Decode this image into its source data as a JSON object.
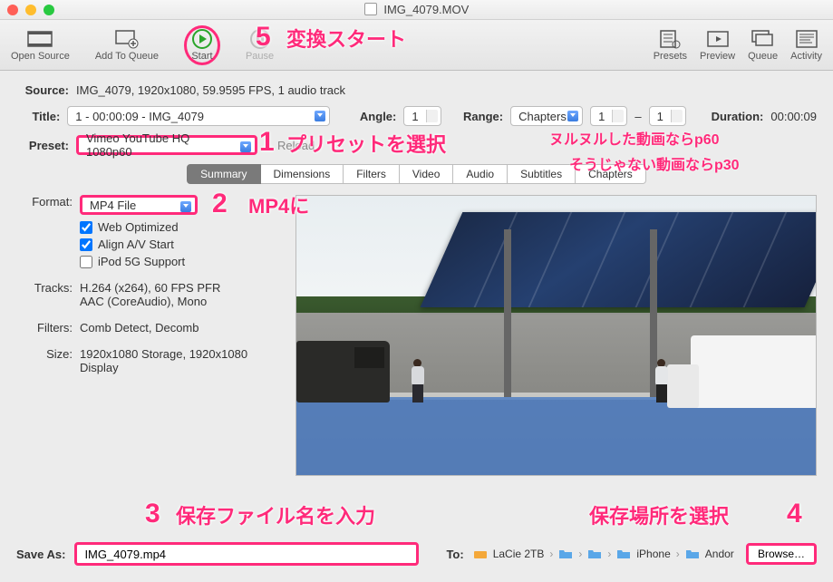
{
  "window_title": "IMG_4079.MOV",
  "toolbar": {
    "open_source": "Open Source",
    "add_to_queue": "Add To Queue",
    "start": "Start",
    "pause": "Pause",
    "presets": "Presets",
    "preview": "Preview",
    "queue": "Queue",
    "activity": "Activity"
  },
  "source": {
    "label": "Source:",
    "value": "IMG_4079, 1920x1080, 59.9595 FPS, 1 audio track"
  },
  "title_row": {
    "label": "Title:",
    "select": "1 - 00:00:09 - IMG_4079"
  },
  "angle": {
    "label": "Angle:",
    "value": "1"
  },
  "range": {
    "label": "Range:",
    "mode": "Chapters",
    "from": "1",
    "to": "1",
    "dash": "–"
  },
  "duration": {
    "label": "Duration:",
    "value": "00:00:09"
  },
  "preset": {
    "label": "Preset:",
    "value": "Vimeo YouTube HQ 1080p60",
    "reload": "Reload"
  },
  "tabs": [
    "Summary",
    "Dimensions",
    "Filters",
    "Video",
    "Audio",
    "Subtitles",
    "Chapters"
  ],
  "format": {
    "label": "Format:",
    "value": "MP4 File"
  },
  "checks": {
    "web_optimized": "Web Optimized",
    "align_av": "Align A/V Start",
    "ipod": "iPod 5G Support"
  },
  "tracks": {
    "label": "Tracks:",
    "line1": "H.264 (x264), 60 FPS PFR",
    "line2": "AAC (CoreAudio), Mono"
  },
  "filters": {
    "label": "Filters:",
    "value": "Comb Detect, Decomb"
  },
  "size": {
    "label": "Size:",
    "value": "1920x1080 Storage, 1920x1080 Display"
  },
  "save_as": {
    "label": "Save As:",
    "value": "IMG_4079.mp4"
  },
  "dest": {
    "label": "To:",
    "drive": "LaCie 2TB",
    "p3": "iPhone",
    "p4": "Andor",
    "browse": "Browse…"
  },
  "annotations": {
    "n1": "1",
    "t1": "プリセットを選択",
    "sub1": "ヌルヌルした動画ならp60",
    "sub2": "そうじゃない動画ならp30",
    "n2": "2",
    "t2": "MP4に",
    "n3": "3",
    "t3": "保存ファイル名を入力",
    "n4": "4",
    "t4": "保存場所を選択",
    "n5": "5",
    "t5": "変換スタート"
  }
}
